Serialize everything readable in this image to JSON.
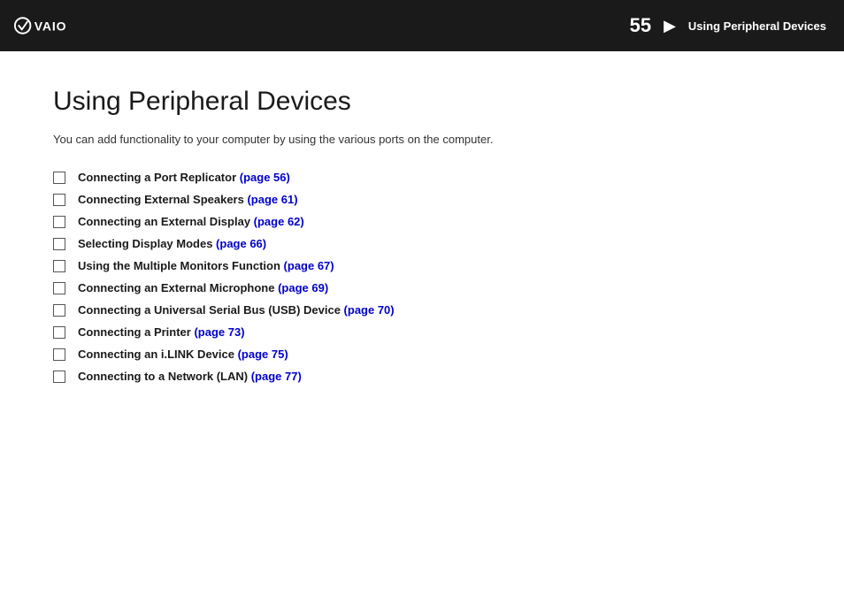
{
  "header": {
    "page_number": "55",
    "arrow": "▶",
    "section_title": "Using Peripheral Devices"
  },
  "main": {
    "page_title": "Using Peripheral Devices",
    "intro": "You can add functionality to your computer by using the various ports on the computer.",
    "items": [
      {
        "text": "Connecting a Port Replicator ",
        "link_text": "(page 56)",
        "link_ref": "page56"
      },
      {
        "text": "Connecting External Speakers ",
        "link_text": "(page 61)",
        "link_ref": "page61"
      },
      {
        "text": "Connecting an External Display ",
        "link_text": "(page 62)",
        "link_ref": "page62"
      },
      {
        "text": "Selecting Display Modes ",
        "link_text": "(page 66)",
        "link_ref": "page66"
      },
      {
        "text": "Using the Multiple Monitors Function ",
        "link_text": "(page 67)",
        "link_ref": "page67"
      },
      {
        "text": "Connecting an External Microphone ",
        "link_text": "(page 69)",
        "link_ref": "page69"
      },
      {
        "text": "Connecting a Universal Serial Bus (USB) Device ",
        "link_text": "(page 70)",
        "link_ref": "page70"
      },
      {
        "text": "Connecting a Printer ",
        "link_text": "(page 73)",
        "link_ref": "page73"
      },
      {
        "text": "Connecting an i.LINK Device ",
        "link_text": "(page 75)",
        "link_ref": "page75"
      },
      {
        "text": "Connecting to a Network (LAN) ",
        "link_text": "(page 77)",
        "link_ref": "page77"
      }
    ]
  },
  "logo": {
    "alt": "VAIO"
  }
}
